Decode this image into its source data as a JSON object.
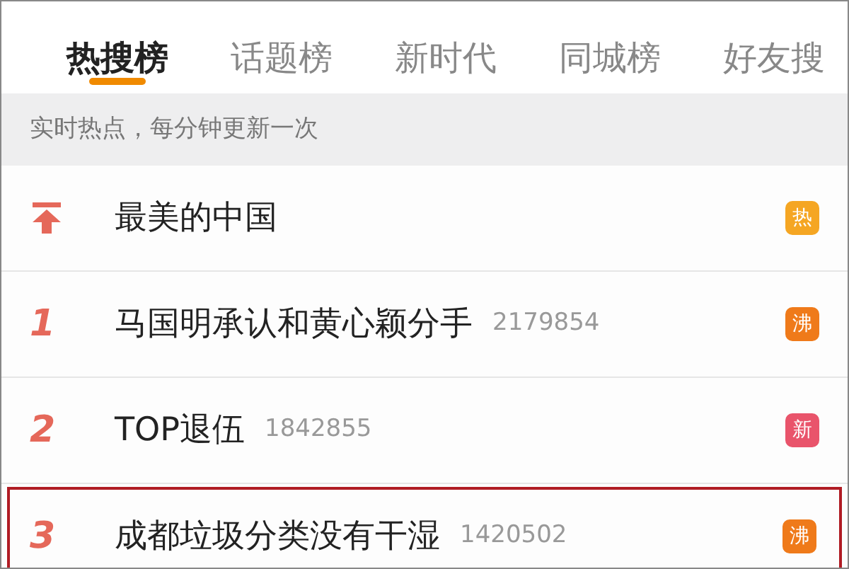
{
  "tabs": [
    {
      "label": "热搜榜",
      "selected": true
    },
    {
      "label": "话题榜",
      "selected": false
    },
    {
      "label": "新时代",
      "selected": false
    },
    {
      "label": "同城榜",
      "selected": false
    },
    {
      "label": "好友搜",
      "selected": false
    }
  ],
  "notice": "实时热点，每分钟更新一次",
  "items": [
    {
      "kind": "pinned",
      "title": "最美的中国",
      "badge": "热",
      "color": "#f5a623",
      "highlighted": false
    },
    {
      "kind": "rank",
      "rank": "1",
      "title": "马国明承认和黄心颖分手",
      "count": "2179854",
      "badge": "沸",
      "color": "#ef7a1a",
      "highlighted": false
    },
    {
      "kind": "rank",
      "rank": "2",
      "title": "TOP退伍",
      "count": "1842855",
      "badge": "新",
      "color": "#e9546b",
      "highlighted": false
    },
    {
      "kind": "rank",
      "rank": "3",
      "title": "成都垃圾分类没有干湿",
      "count": "1420502",
      "badge": "沸",
      "color": "#ef7a1a",
      "highlighted": true
    }
  ]
}
